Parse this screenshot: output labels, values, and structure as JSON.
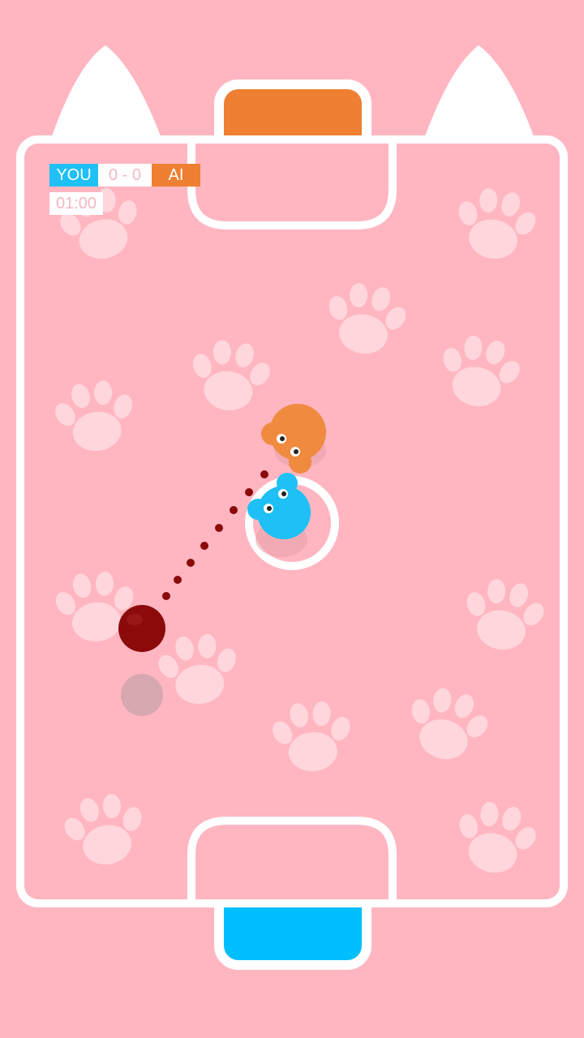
{
  "colors": {
    "field": "#ffb6c1",
    "paw": "#ffd6dc",
    "lines": "#ffffff",
    "player": "#1ec0f5",
    "opponent": "#f08a3f",
    "ball": "#8b0a0a",
    "opponent_goal": "#ef7f32",
    "player_goal": "#00bfff",
    "score_text": "#f4b7c2"
  },
  "hud": {
    "you_label": "YOU",
    "score": "0 - 0",
    "ai_label": "AI",
    "timer": "01:00"
  },
  "icons": {
    "paw": "paw-print-icon",
    "player": "blue-cat-player",
    "opponent": "orange-cat-opponent",
    "ball": "ball"
  }
}
